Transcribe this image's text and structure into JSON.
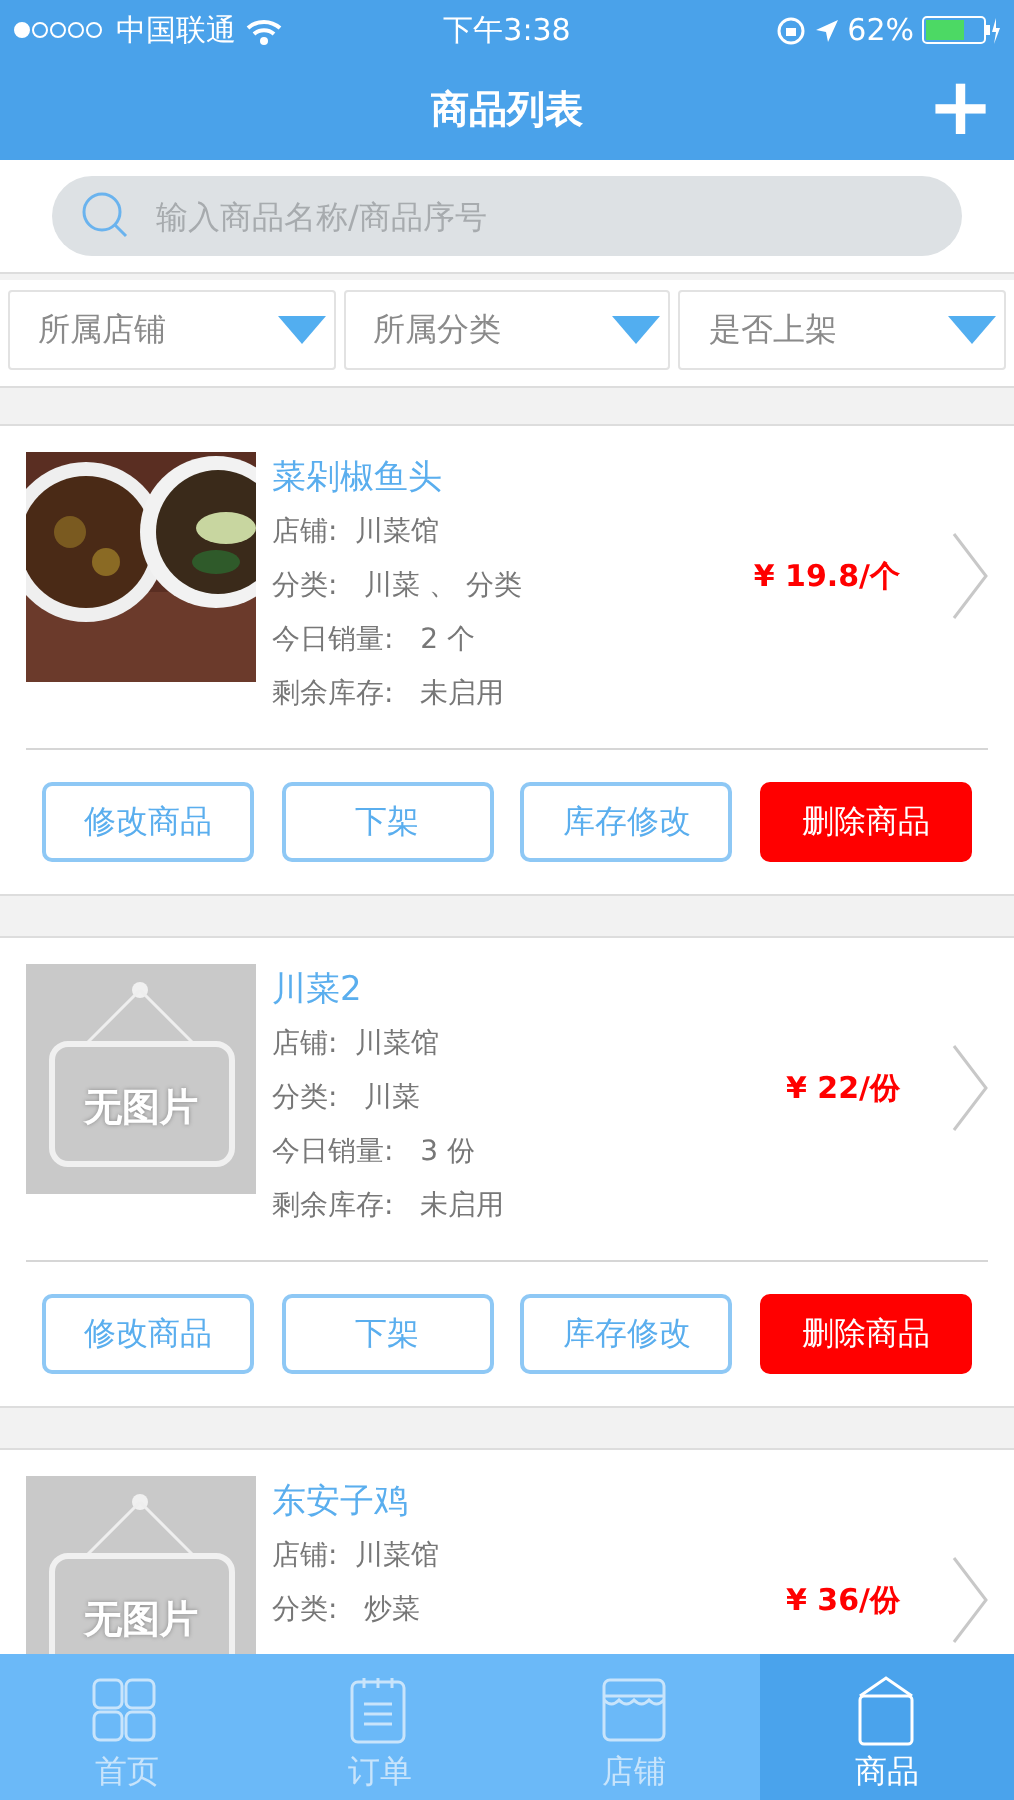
{
  "status_bar": {
    "carrier": "中国联通",
    "time": "下午3:38",
    "battery": "62%"
  },
  "nav": {
    "title": "商品列表",
    "add": "+"
  },
  "search": {
    "placeholder": "输入商品名称/商品序号"
  },
  "filters": [
    {
      "label": "所属店铺"
    },
    {
      "label": "所属分类"
    },
    {
      "label": "是否上架"
    }
  ],
  "products": [
    {
      "name": "菜剁椒鱼头",
      "details": [
        "店铺:  川菜馆",
        "分类:   川菜 、 分类",
        "今日销量:   2 个",
        "剩余库存:   未启用"
      ],
      "price": "¥ 19.8/个",
      "actions": [
        {
          "label": "修改商品",
          "kind": "outline"
        },
        {
          "label": "下架",
          "kind": "outline"
        },
        {
          "label": "库存修改",
          "kind": "outline"
        },
        {
          "label": "删除商品",
          "kind": "danger"
        }
      ]
    },
    {
      "name": "川菜2",
      "image": {
        "kind": "placeholder",
        "label": "无图片"
      },
      "details": [
        "店铺:  川菜馆",
        "分类:   川菜",
        "今日销量:   3 份",
        "剩余库存:   未启用"
      ],
      "price": "¥ 22/份",
      "actions": [
        {
          "label": "修改商品",
          "kind": "outline"
        },
        {
          "label": "下架",
          "kind": "outline"
        },
        {
          "label": "库存修改",
          "kind": "outline"
        },
        {
          "label": "删除商品",
          "kind": "danger"
        }
      ]
    },
    {
      "name": "东安子鸡",
      "image": {
        "kind": "placeholder",
        "label": "无图片"
      },
      "details": [
        "店铺:  川菜馆",
        "分类:   炒菜"
      ],
      "price": "¥ 36/份"
    }
  ],
  "tabs": [
    {
      "label": "首页",
      "selected": false
    },
    {
      "label": "订单",
      "selected": false
    },
    {
      "label": "店铺",
      "selected": false
    },
    {
      "label": "商品",
      "selected": true
    }
  ]
}
